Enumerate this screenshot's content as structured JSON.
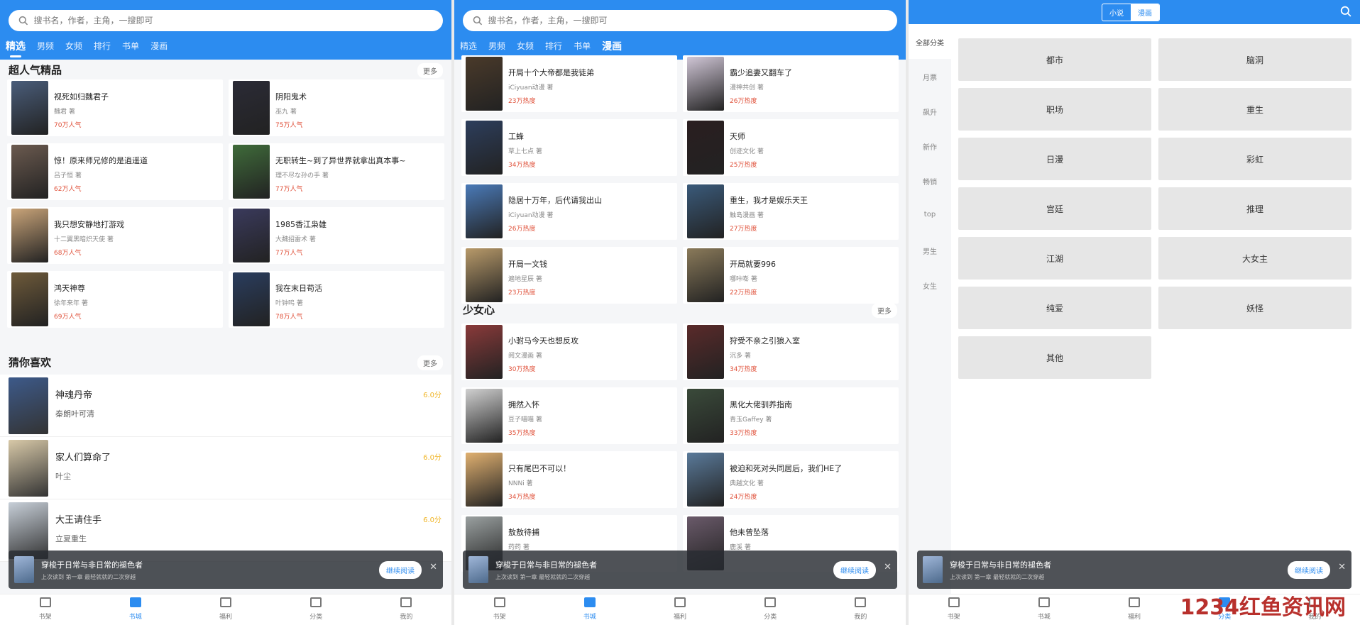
{
  "search_placeholder": "搜书名，作者，主角，一搜即可",
  "panel1": {
    "tabs": [
      "精选",
      "男频",
      "女频",
      "排行",
      "书单",
      "漫画"
    ],
    "section1_title": "超人气精品",
    "more": "更多",
    "cards": [
      {
        "title": "视死如归魏君子",
        "author": "魏君 著",
        "hot": "70万人气",
        "color": "#4a5d7a"
      },
      {
        "title": "阴阳鬼术",
        "author": "巫九 著",
        "hot": "75万人气",
        "color": "#2b2b36"
      },
      {
        "title": "惊！原来师兄修的是逍遥道",
        "author": "吕子恒 著",
        "hot": "62万人气",
        "color": "#6b5a4f"
      },
      {
        "title": "无职转生~到了异世界就拿出真本事~",
        "author": "理不尽な孙の手 著",
        "hot": "77万人气",
        "color": "#3f6b3a"
      },
      {
        "title": "我只想安静地打游戏",
        "author": "十二翼黑暗炽天使 著",
        "hot": "68万人气",
        "color": "#c9a479"
      },
      {
        "title": "1985香江枭雄",
        "author": "大魏招雷术 著",
        "hot": "77万人气",
        "color": "#3a3a5c"
      },
      {
        "title": "鸿天神尊",
        "author": "徐年来年 著",
        "hot": "69万人气",
        "color": "#6e5a3a"
      },
      {
        "title": "我在末日苟活",
        "author": "叶钟鸣 著",
        "hot": "78万人气",
        "color": "#2a3d5e"
      }
    ],
    "section2_title": "猜你喜欢",
    "list": [
      {
        "title": "神魂丹帝",
        "author": "秦朗叶可清",
        "score": "6.0分",
        "color": "#3d5a8a"
      },
      {
        "title": "家人们算命了",
        "author": "叶尘",
        "score": "6.0分",
        "color": "#d8c9a8"
      },
      {
        "title": "大王请住手",
        "author": "立夏重生",
        "score": "6.0分",
        "color": "#c7cfd8"
      }
    ]
  },
  "panel2": {
    "tabs": [
      "精选",
      "男频",
      "女频",
      "排行",
      "书单",
      "漫画"
    ],
    "cards_top": [
      {
        "title": "开局十个大帝都是我徒弟",
        "author": "iCiyuan动漫 著",
        "hot": "23万热度",
        "color": "#4a3a2a"
      },
      {
        "title": "霸少追妻又翻车了",
        "author": "漫神共创 著",
        "hot": "26万热度",
        "color": "#d0c6d6"
      },
      {
        "title": "工蜂",
        "author": "草上七点 著",
        "hot": "34万热度",
        "color": "#2d3e5c"
      },
      {
        "title": "天师",
        "author": "创迹文化 著",
        "hot": "25万热度",
        "color": "#2a1e20"
      },
      {
        "title": "隐居十万年，后代请我出山",
        "author": "iCiyuan动漫 著",
        "hot": "26万热度",
        "color": "#4a7ab8"
      },
      {
        "title": "重生，我才是娱乐天王",
        "author": "触岛漫画 著",
        "hot": "27万热度",
        "color": "#3a5a7a"
      },
      {
        "title": "开局一文钱",
        "author": "遍地星辰 著",
        "hot": "23万热度",
        "color": "#b89a6a"
      },
      {
        "title": "开局就要996",
        "author": "哪咔嘭 著",
        "hot": "22万热度",
        "color": "#8a7a5a"
      }
    ],
    "section_title": "少女心",
    "more": "更多",
    "cards_bottom": [
      {
        "title": "小驸马今天也想反攻",
        "author": "阅文漫画 著",
        "hot": "30万热度",
        "color": "#8a3a3a"
      },
      {
        "title": "狩受不亲之引狼入室",
        "author": "沉多 著",
        "hot": "34万热度",
        "color": "#5a2a2a"
      },
      {
        "title": "拥然入怀",
        "author": "豆子喵喵 著",
        "hot": "35万热度",
        "color": "#d0d0d0"
      },
      {
        "title": "黑化大佬驯养指南",
        "author": "青玉Gaffey 著",
        "hot": "33万热度",
        "color": "#3a4a3a"
      },
      {
        "title": "只有尾巴不可以！",
        "author": "NNNi 著",
        "hot": "34万热度",
        "color": "#e0b070"
      },
      {
        "title": "被迫和死对头同居后，我们HE了",
        "author": "典越文化 著",
        "hot": "24万热度",
        "color": "#5a7a9a"
      },
      {
        "title": "敖敖待捕",
        "author": "药药 著",
        "hot": "",
        "color": "#9aa0a0"
      },
      {
        "title": "他未曾坠落",
        "author": "鹿溪 著",
        "hot": "",
        "color": "#6a5a6a"
      }
    ]
  },
  "panel3": {
    "segment": [
      "小说",
      "漫画"
    ],
    "side_items": [
      "全部分类",
      "月票",
      "飙升",
      "新作",
      "畅销",
      "top",
      "男生",
      "女生"
    ],
    "categories": [
      "都市",
      "脑洞",
      "职场",
      "重生",
      "日漫",
      "彩虹",
      "宫廷",
      "推理",
      "江湖",
      "大女主",
      "纯爱",
      "妖怪",
      "其他"
    ]
  },
  "banner": {
    "title": "穿梭于日常与非日常的褪色者",
    "sub": "上次读到 第一章 最轻就就的二次穿越",
    "button": "继续阅读",
    "close": "✕"
  },
  "nav": [
    "书架",
    "书城",
    "福利",
    "分类",
    "我的"
  ],
  "watermark": "1234红鱼资讯网"
}
